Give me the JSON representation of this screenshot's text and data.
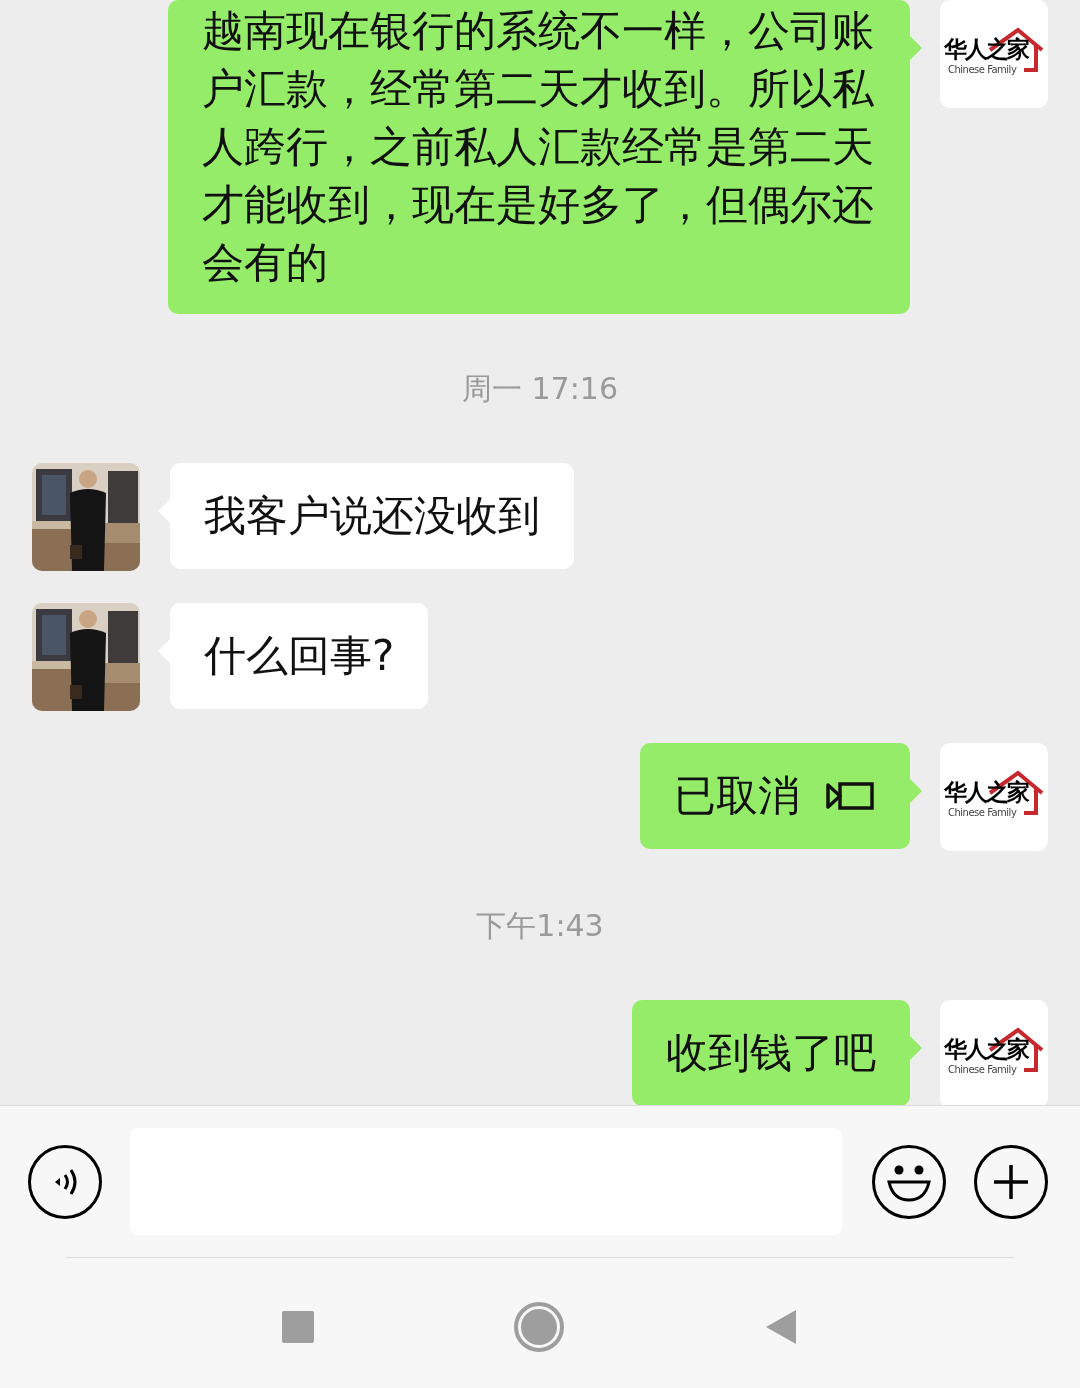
{
  "messages": [
    {
      "kind": "text",
      "outgoing": true,
      "text": "越南现在银行的系统不一样，公司账户汇款，经常第二天才收到。所以私人跨行，之前私人汇款经常是第二天才能收到，现在是好多了，但偶尔还会有的",
      "avatar": {
        "logo_text": "华人之家",
        "logo_subtitle": "Chinese Family"
      }
    },
    {
      "kind": "time",
      "text": "周一 17:16"
    },
    {
      "kind": "text",
      "outgoing": false,
      "text": "我客户说还没收到"
    },
    {
      "kind": "text",
      "outgoing": false,
      "text": "什么回事?"
    },
    {
      "kind": "call",
      "outgoing": true,
      "text": "已取消",
      "avatar": {
        "logo_text": "华人之家",
        "logo_subtitle": "Chinese Family"
      }
    },
    {
      "kind": "time",
      "text": "下午1:43"
    },
    {
      "kind": "text",
      "outgoing": true,
      "text": "收到钱了吧",
      "avatar": {
        "logo_text": "华人之家",
        "logo_subtitle": "Chinese Family"
      }
    }
  ]
}
